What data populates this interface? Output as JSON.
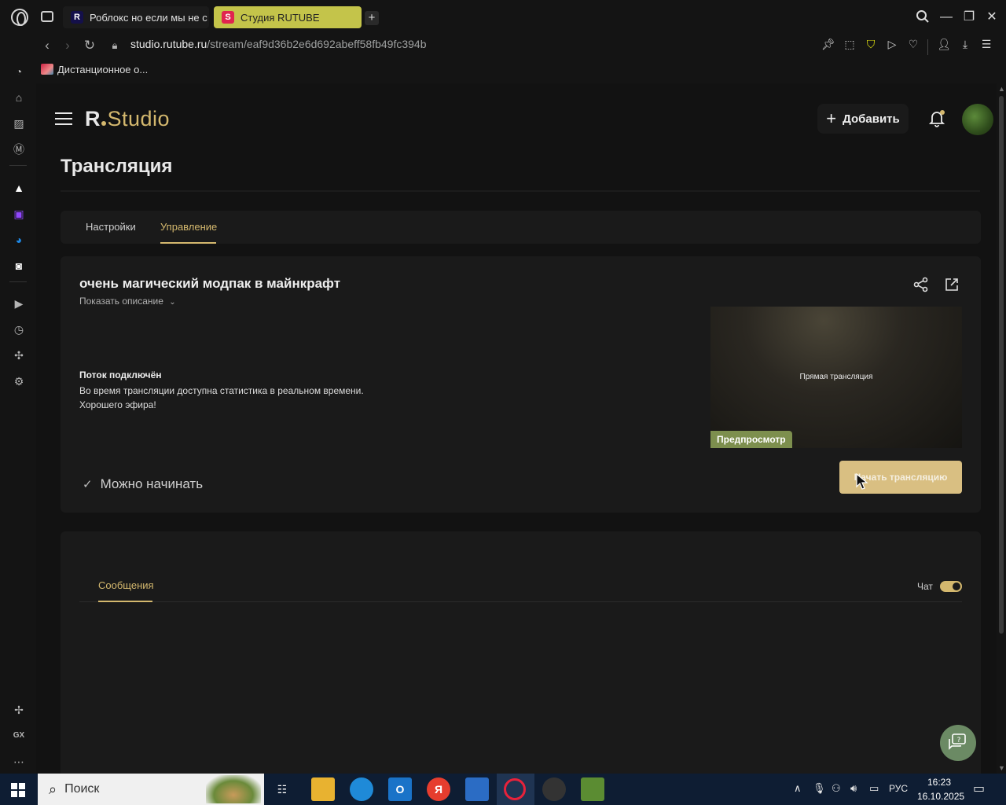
{
  "browser": {
    "tabs": [
      {
        "favicon": "R",
        "label": "Роблокс но если мы не с"
      },
      {
        "favicon": "S",
        "label": "Студия RUTUBE"
      }
    ],
    "url_domain": "studio.rutube.ru",
    "url_path": "/stream/eaf9d36b2e6d692abeff58fb49fc394b",
    "bookmark": "Дистанционное о...",
    "sidebar_bottom_label": "GX"
  },
  "header": {
    "logo_r": "R",
    "logo_studio": "Studio",
    "add_label": "Добавить"
  },
  "page": {
    "title": "Трансляция",
    "tabs": [
      "Настройки",
      "Управление"
    ],
    "active_tab": "Управление"
  },
  "stream": {
    "title": "очень магический модпак в майнкрафт",
    "show_description": "Показать описание",
    "status_title": "Поток подключён",
    "status_line1": "Во время трансляции доступна статистика в реальном времени.",
    "status_line2": "Хорошего эфира!",
    "preview_label": "Прямая трансляция",
    "preview_badge": "Предпросмотр",
    "ready_text": "Можно начинать",
    "start_button": "Начать трансляцию"
  },
  "chat": {
    "tab": "Сообщения",
    "toggle_label": "Чат",
    "toggle_on": true
  },
  "taskbar": {
    "search_placeholder": "Поиск",
    "lang": "РУС",
    "time": "16:23",
    "date": "16.10.2025"
  },
  "colors": {
    "accent": "#d4b86e",
    "active_tab_bg": "#c4c44a",
    "background": "#121212",
    "card": "#1a1a1a",
    "taskbar": "#0e1d33"
  }
}
